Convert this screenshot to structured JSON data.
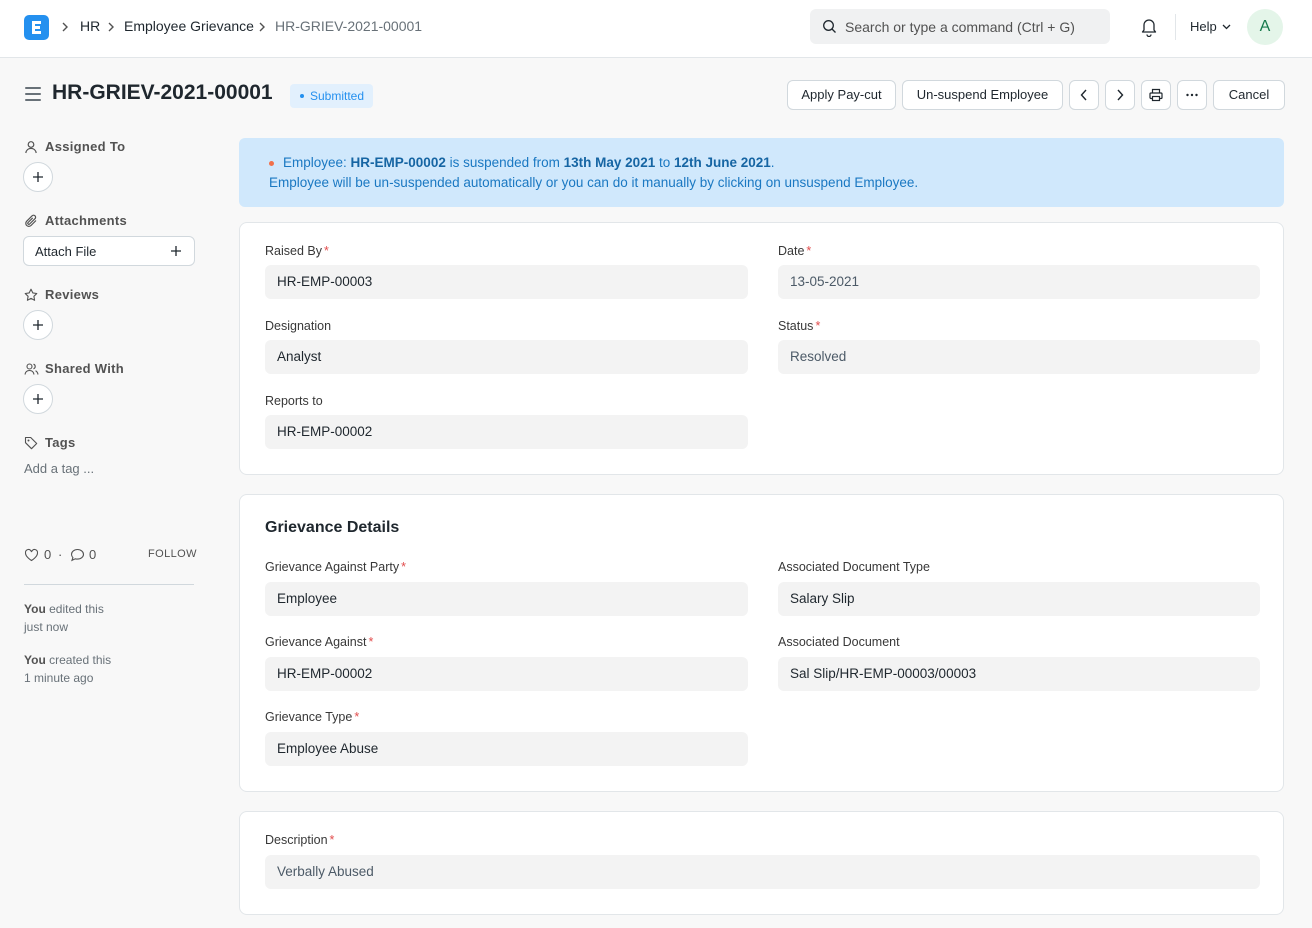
{
  "navbar": {
    "breadcrumbs": [
      "HR",
      "Employee Grievance",
      "HR-GRIEV-2021-00001"
    ],
    "search_placeholder": "Search or type a command (Ctrl + G)",
    "help_label": "Help",
    "avatar_initial": "A"
  },
  "page": {
    "title": "HR-GRIEV-2021-00001",
    "status": "Submitted",
    "buttons": {
      "apply_pay_cut": "Apply Pay-cut",
      "unsuspend": "Un-suspend Employee",
      "cancel": "Cancel"
    }
  },
  "sidebar": {
    "assigned_to": "Assigned To",
    "attachments": "Attachments",
    "attach_file": "Attach File",
    "reviews": "Reviews",
    "shared_with": "Shared With",
    "tags": "Tags",
    "add_tag": "Add a tag ...",
    "likes": "0",
    "comments": "0",
    "separator": "·",
    "follow": "FOLLOW",
    "activity": [
      {
        "who": "You",
        "action": "edited this",
        "when": "just now"
      },
      {
        "who": "You",
        "action": "created this",
        "when": "1 minute ago"
      }
    ]
  },
  "alert": {
    "p1": "Employee: ",
    "employee": "HR-EMP-00002",
    "p2": " is suspended from ",
    "from": "13th May 2021",
    "p3": " to ",
    "to": "12th June 2021",
    "p4": ".",
    "line2": "Employee will be un-suspended automatically or you can do it manually by clicking on unsuspend Employee."
  },
  "details": {
    "raised_by": {
      "label": "Raised By",
      "value": "HR-EMP-00003"
    },
    "date": {
      "label": "Date",
      "value": "13-05-2021"
    },
    "designation": {
      "label": "Designation",
      "value": "Analyst"
    },
    "status": {
      "label": "Status",
      "value": "Resolved"
    },
    "reports_to": {
      "label": "Reports to",
      "value": "HR-EMP-00002"
    }
  },
  "grievance": {
    "title": "Grievance Details",
    "against_party": {
      "label": "Grievance Against Party",
      "value": "Employee"
    },
    "assoc_doc_type": {
      "label": "Associated Document Type",
      "value": "Salary Slip"
    },
    "against": {
      "label": "Grievance Against",
      "value": "HR-EMP-00002"
    },
    "assoc_doc": {
      "label": "Associated Document",
      "value": "Sal Slip/HR-EMP-00003/00003"
    },
    "type": {
      "label": "Grievance Type",
      "value": "Employee Abuse"
    }
  },
  "description": {
    "label": "Description",
    "value": "Verbally Abused"
  },
  "colors": {
    "primary": "#2490ef",
    "required": "#e24c4c",
    "alert_bg": "#d0e8fc"
  }
}
